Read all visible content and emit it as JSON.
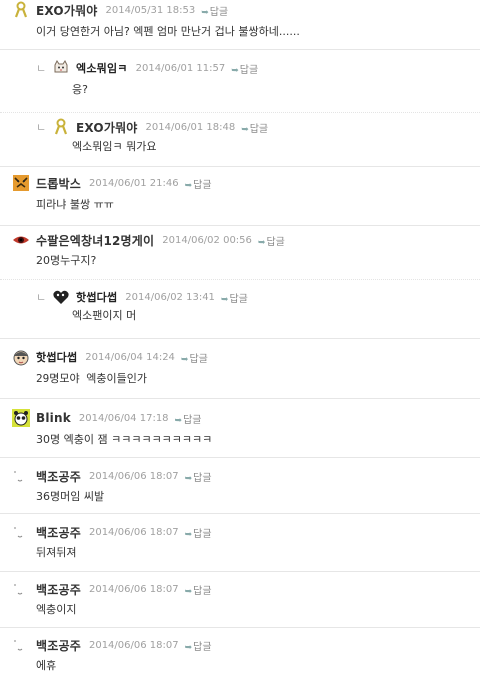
{
  "comments": [
    {
      "nick": "EXO가뭐야",
      "date": "2014/05/31 18:53",
      "reply_label": "답글",
      "text": "이거 당연한거 아님? 엑펜 엄마 만난거 겁나 불쌍하네......",
      "avatar": "ribbon-icon",
      "reply": false
    },
    {
      "nick": "엑소뭐임ㅋ",
      "date": "2014/06/01 11:57",
      "reply_label": "답글",
      "text": "응?",
      "avatar": "cat-icon",
      "reply": true
    },
    {
      "nick": "EXO가뭐야",
      "date": "2014/06/01 18:48",
      "reply_label": "답글",
      "text": "엑소뭐임ㅋ  뭐가요",
      "avatar": "ribbon-icon",
      "reply": true
    },
    {
      "nick": "드롭박스",
      "date": "2014/06/01 21:46",
      "reply_label": "답글",
      "text": "피라냐 불쌍 ㅠㅠ",
      "avatar": "tiger-icon",
      "reply": false
    },
    {
      "nick": "수팔은엑창녀12명게이",
      "date": "2014/06/02 00:56",
      "reply_label": "답글",
      "text": "20명누구지?",
      "avatar": "eye-icon",
      "reply": false
    },
    {
      "nick": "핫썹다썹",
      "date": "2014/06/02 13:41",
      "reply_label": "답글",
      "text": "엑소팬이지 머",
      "avatar": "heart-icon",
      "reply": true
    },
    {
      "nick": "핫썹다썹",
      "date": "2014/06/04 14:24",
      "reply_label": "답글",
      "text": "29명모야 엑충이들인가",
      "avatar": "face-icon",
      "reply": false
    },
    {
      "nick": "Blink",
      "date": "2014/06/04 17:18",
      "reply_label": "답글",
      "text": "30명 엑충이 잼 ㅋㅋㅋㅋㅋㅋㅋㅋㅋㅋ",
      "avatar": "panda-icon",
      "reply": false
    },
    {
      "nick": "백조공주",
      "date": "2014/06/06 18:07",
      "reply_label": "답글",
      "text": "36명머임 씨발",
      "avatar": "smile-icon",
      "reply": false
    },
    {
      "nick": "백조공주",
      "date": "2014/06/06 18:07",
      "reply_label": "답글",
      "text": "뒤져뒤져",
      "avatar": "smile-icon",
      "reply": false
    },
    {
      "nick": "백조공주",
      "date": "2014/06/06 18:07",
      "reply_label": "답글",
      "text": "엑충이지",
      "avatar": "smile-icon",
      "reply": false
    },
    {
      "nick": "백조공주",
      "date": "2014/06/06 18:07",
      "reply_label": "답글",
      "text": "에휴",
      "avatar": "smile-icon",
      "reply": false
    }
  ],
  "colors": {
    "accent": "#8aa",
    "date": "#a0a0a0",
    "divider": "#e6e6e6"
  }
}
